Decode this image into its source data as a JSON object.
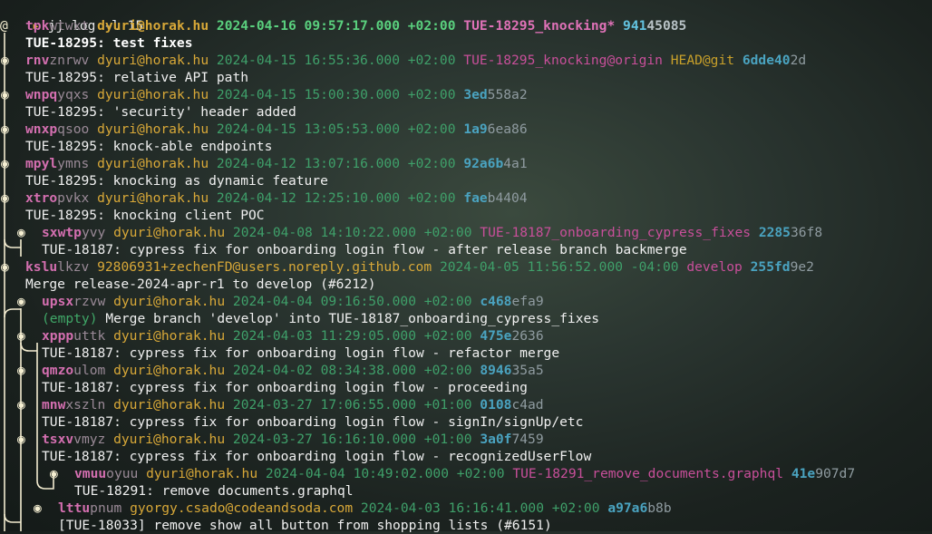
{
  "prompt": {
    "arrow": "▸",
    "command": "jj log -l 15"
  },
  "commits": [
    {
      "graph": "@",
      "id_hi": "tpk",
      "id_lo": "wtwxt",
      "author": "dyuri@horak.hu",
      "timestamp": "2024-04-16 09:57:17.000 +02:00",
      "bookmarks": "TUE-18295_knocking*",
      "git_head": "",
      "hash_hi": "941",
      "hash_lo": "45085",
      "description": "TUE-18295: test fixes",
      "current": true
    },
    {
      "graph": "◉",
      "id_hi": "rnv",
      "id_lo": "znrwv",
      "author": "dyuri@horak.hu",
      "timestamp": "2024-04-15 16:55:36.000 +02:00",
      "bookmarks": "TUE-18295_knocking@origin",
      "git_head": "HEAD@git",
      "hash_hi": "6dde40",
      "hash_lo": "2d",
      "description": "TUE-18295: relative API path"
    },
    {
      "graph": "◉",
      "id_hi": "wnpq",
      "id_lo": "yqxs",
      "author": "dyuri@horak.hu",
      "timestamp": "2024-04-15 15:00:30.000 +02:00",
      "bookmarks": "",
      "git_head": "",
      "hash_hi": "3ed",
      "hash_lo": "558a2",
      "description": "TUE-18295: 'security' header added"
    },
    {
      "graph": "◉",
      "id_hi": "wnxp",
      "id_lo": "qsoo",
      "author": "dyuri@horak.hu",
      "timestamp": "2024-04-15 13:05:53.000 +02:00",
      "bookmarks": "",
      "git_head": "",
      "hash_hi": "1a9",
      "hash_lo": "6ea86",
      "description": "TUE-18295: knock-able endpoints"
    },
    {
      "graph": "◉",
      "id_hi": "mpyl",
      "id_lo": "ymns",
      "author": "dyuri@horak.hu",
      "timestamp": "2024-04-12 13:07:16.000 +02:00",
      "bookmarks": "",
      "git_head": "",
      "hash_hi": "92a6b",
      "hash_lo": "4a1",
      "description": "TUE-18295: knocking as dynamic feature"
    },
    {
      "graph": "◉",
      "id_hi": "xtro",
      "id_lo": "pvkx",
      "author": "dyuri@horak.hu",
      "timestamp": "2024-04-12 12:25:10.000 +02:00",
      "bookmarks": "",
      "git_head": "",
      "hash_hi": "fae",
      "hash_lo": "b4404",
      "description": "TUE-18295: knocking client POC"
    },
    {
      "graph": "◉",
      "id_hi": "sxwtp",
      "id_lo": "yvy",
      "author": "dyuri@horak.hu",
      "timestamp": "2024-04-08 14:10:22.000 +02:00",
      "bookmarks": "TUE-18187_onboarding_cypress_fixes",
      "git_head": "",
      "hash_hi": "2285",
      "hash_lo": "36f8",
      "description": "TUE-18187: cypress fix for onboarding login flow - after release branch backmerge"
    },
    {
      "graph": "◉",
      "id_hi": "kslu",
      "id_lo": "lkzv",
      "author": "92806931+zechenFD@users.noreply.github.com",
      "timestamp": "2024-04-05 11:56:52.000 -04:00",
      "bookmarks": "develop",
      "git_head": "",
      "hash_hi": "255fd",
      "hash_lo": "9e2",
      "description": "Merge release-2024-apr-r1 to develop (#6212)"
    },
    {
      "graph": "◉",
      "id_hi": "upsx",
      "id_lo": "rzvw",
      "author": "dyuri@horak.hu",
      "timestamp": "2024-04-04 09:16:50.000 +02:00",
      "bookmarks": "",
      "git_head": "",
      "hash_hi": "c468",
      "hash_lo": "efa9",
      "empty": "(empty)",
      "description": "Merge branch 'develop' into TUE-18187_onboarding_cypress_fixes"
    },
    {
      "graph": "◉",
      "id_hi": "xppp",
      "id_lo": "uttk",
      "author": "dyuri@horak.hu",
      "timestamp": "2024-04-03 11:29:05.000 +02:00",
      "bookmarks": "",
      "git_head": "",
      "hash_hi": "475e",
      "hash_lo": "2636",
      "description": "TUE-18187: cypress fix for onboarding login flow - refactor merge"
    },
    {
      "graph": "◉",
      "id_hi": "qmzo",
      "id_lo": "ulom",
      "author": "dyuri@horak.hu",
      "timestamp": "2024-04-02 08:34:38.000 +02:00",
      "bookmarks": "",
      "git_head": "",
      "hash_hi": "8946",
      "hash_lo": "35a5",
      "description": "TUE-18187: cypress fix for onboarding login flow - proceeding"
    },
    {
      "graph": "◉",
      "id_hi": "mnw",
      "id_lo": "xszln",
      "author": "dyuri@horak.hu",
      "timestamp": "2024-03-27 17:06:55.000 +01:00",
      "bookmarks": "",
      "git_head": "",
      "hash_hi": "0108",
      "hash_lo": "c4ad",
      "description": "TUE-18187: cypress fix for onboarding login flow - signIn/signUp/etc"
    },
    {
      "graph": "◉",
      "id_hi": "tsxv",
      "id_lo": "vmyz",
      "author": "dyuri@horak.hu",
      "timestamp": "2024-03-27 16:16:10.000 +01:00",
      "bookmarks": "",
      "git_head": "",
      "hash_hi": "3a0f",
      "hash_lo": "7459",
      "description": "TUE-18187: cypress fix for onboarding login flow - recognizedUserFlow"
    },
    {
      "graph": "◉",
      "id_hi": "vmuu",
      "id_lo": "oyuu",
      "author": "dyuri@horak.hu",
      "timestamp": "2024-04-04 10:49:02.000 +02:00",
      "bookmarks": "TUE-18291_remove_documents.graphql",
      "git_head": "",
      "hash_hi": "41e",
      "hash_lo": "907d7",
      "description": "TUE-18291: remove documents.graphql"
    },
    {
      "graph": "◉",
      "id_hi": "lttu",
      "id_lo": "pnum",
      "author": "gyorgy.csado@codeandsoda.com",
      "timestamp": "2024-04-03 16:16:41.000 +02:00",
      "bookmarks": "",
      "git_head": "",
      "hash_hi": "a97a6",
      "hash_lo": "b8b",
      "description": "[TUE-18033] remove show all button from shopping lists (#6151)"
    }
  ]
}
